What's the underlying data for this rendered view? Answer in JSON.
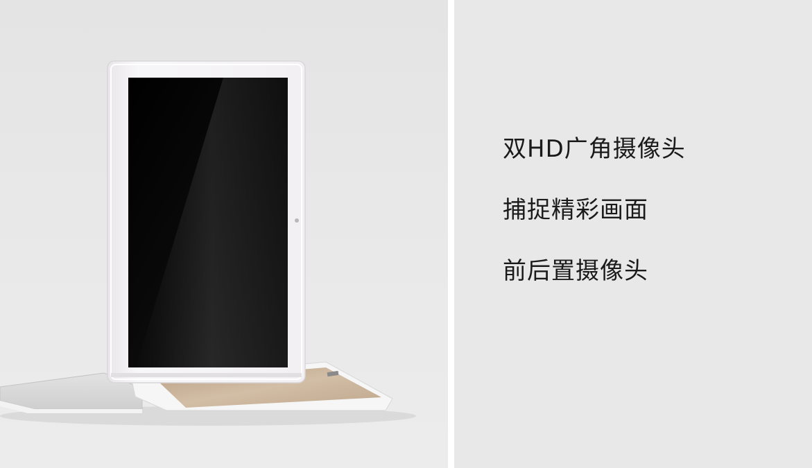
{
  "features": {
    "line1": "双HD广角摄像头",
    "line2": "捕捉精彩画面",
    "line3": "前后置摄像头"
  },
  "colors": {
    "background": "#e8e8e8",
    "divider": "#ffffff",
    "text": "#1a1a1a",
    "tablet_frame": "#f5f3f5",
    "screen": "#050505",
    "tablet_back": "#c9b49a"
  },
  "illustration": "product-photo-white-tablet-upright-on-second-tablet"
}
